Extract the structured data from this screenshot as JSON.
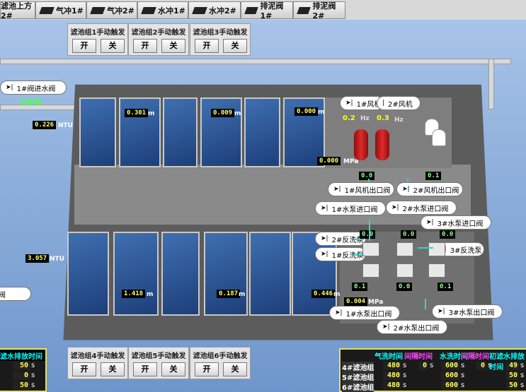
{
  "tabs": [
    {
      "label": "滤池上方2#"
    },
    {
      "label": "气冲1#"
    },
    {
      "label": "气冲2#"
    },
    {
      "label": "水冲1#"
    },
    {
      "label": "水冲2#"
    },
    {
      "label": "排泥阀1#"
    },
    {
      "label": "排泥阀2#"
    }
  ],
  "panels": [
    {
      "title": "滤池组1手动触发",
      "on": "开",
      "off": "关"
    },
    {
      "title": "滤池组2手动触发",
      "on": "开",
      "off": "关"
    },
    {
      "title": "滤池组3手动触发",
      "on": "开",
      "off": "关"
    },
    {
      "title": "滤池组4手动触发",
      "on": "开",
      "off": "关"
    },
    {
      "title": "滤池组5手动触发",
      "on": "开",
      "off": "关"
    },
    {
      "title": "滤池组6手动触发",
      "on": "开",
      "off": "关"
    }
  ],
  "inlet": {
    "valve": "1#阀进水阀",
    "label": "进水阀",
    "ntu_top": "0.226",
    "ntu_bottom": "3.057",
    "ntu_unit": "NTU",
    "left_valve": "水阀"
  },
  "levels": {
    "top": [
      "0.301",
      "0.009",
      "0.000"
    ],
    "bottom": [
      "1.418",
      "0.187",
      "0.446"
    ],
    "unit": "m"
  },
  "fans": {
    "fan1": "1#风机",
    "fan2": "2#风机",
    "hz1": "0.2",
    "hz2": "0.3",
    "hz_unit": "Hz",
    "pressure": "0.000",
    "pressure_unit": "MPa",
    "out1_val": "0.0",
    "out2_val": "0.1",
    "out1": "1#风机出口阀",
    "out2": "2#风机出口阀"
  },
  "pumps": {
    "in1": "1#水泵进口阀",
    "in2": "2#水泵进口阀",
    "in3": "3#水泵进口阀",
    "back2": "2#反洗泵",
    "back1": "1#反洗泵",
    "back3": "3#反洗泵",
    "v1": "0.0",
    "v2": "0.0",
    "v3": "0.0",
    "b1": "0.1",
    "b2": "0.0",
    "b3": "0.1",
    "pressure": "0.004",
    "pressure_unit": "MPa",
    "out1": "1#水泵出口阀",
    "out2": "2#水泵出口阀",
    "out3": "3#水泵出口阀"
  },
  "drain": {
    "title": "滤水排放时间",
    "values": [
      "50",
      "0",
      "50"
    ],
    "unit": "s"
  },
  "timing": {
    "headers": [
      "气洗时间",
      "间隔时间",
      "水洗时间",
      "间隔时间",
      "初滤水排放时间"
    ],
    "rows": [
      {
        "name": "4#滤池组",
        "v": [
          "480",
          "0",
          "600",
          "0",
          "49"
        ]
      },
      {
        "name": "5#滤池组",
        "v": [
          "480",
          "",
          "600",
          "",
          "50"
        ]
      },
      {
        "name": "6#滤池组",
        "v": [
          "480",
          "",
          "600",
          "",
          "50"
        ]
      }
    ],
    "unit": "s"
  }
}
